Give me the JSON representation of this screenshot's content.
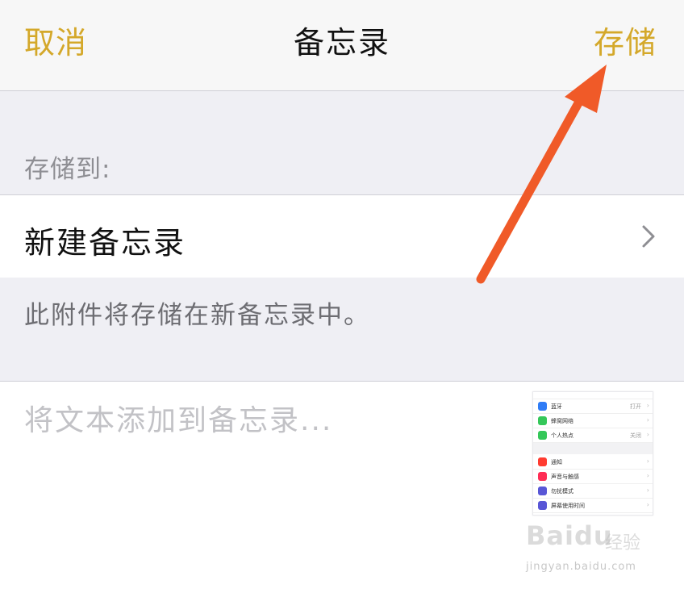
{
  "navbar": {
    "cancel_label": "取消",
    "title": "备忘录",
    "save_label": "存储"
  },
  "save_section": {
    "header": "存储到:",
    "destination_label": "新建备忘录",
    "footer": "此附件将存储在新备忘录中。"
  },
  "note_input": {
    "placeholder": "将文本添加到备忘录...",
    "value": ""
  },
  "attachment_thumbnail": {
    "rows": [
      {
        "label": "蓝牙",
        "value": "打开",
        "color": "#2f7cf6",
        "icon": "bluetooth-icon"
      },
      {
        "label": "蜂窝网络",
        "value": "",
        "color": "#34c759",
        "icon": "cellular-icon"
      },
      {
        "label": "个人热点",
        "value": "关闭",
        "color": "#34c759",
        "icon": "hotspot-icon"
      },
      {
        "label": "通知",
        "value": "",
        "color": "#ff3b30",
        "icon": "notification-icon"
      },
      {
        "label": "声音与触感",
        "value": "",
        "color": "#ff2d55",
        "icon": "sound-icon"
      },
      {
        "label": "勿扰模式",
        "value": "",
        "color": "#5856d6",
        "icon": "moon-icon"
      },
      {
        "label": "屏幕使用时间",
        "value": "",
        "color": "#5856d6",
        "icon": "hourglass-icon"
      }
    ]
  },
  "watermark": {
    "logo": "Baidu",
    "tagline": "经验",
    "url": "jingyan.baidu.com"
  },
  "colors": {
    "accent": "#d4a82a",
    "annotation_arrow": "#f05a28",
    "grouped_background": "#efeff4"
  }
}
